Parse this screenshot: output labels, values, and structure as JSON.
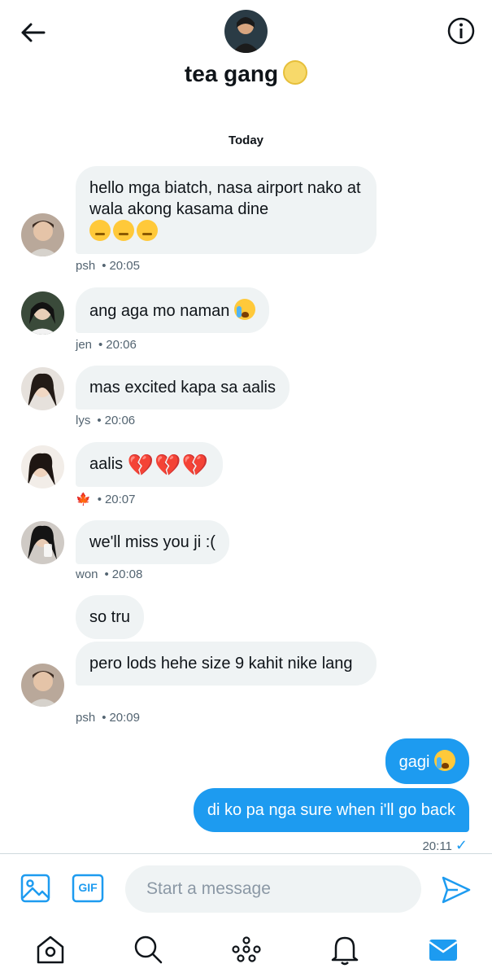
{
  "header": {
    "group_name": "tea gang",
    "back_icon": "arrow-left-icon",
    "info_icon": "info-icon"
  },
  "date_separator": "Today",
  "messages": [
    {
      "sender": "psh",
      "time": "20:05",
      "text": "hello mga biatch, nasa airport nako at wala akong kasama dine"
    },
    {
      "sender": "jen",
      "time": "20:06",
      "text": "ang aga mo naman"
    },
    {
      "sender": "lys",
      "time": "20:06",
      "text": "mas excited kapa sa aalis"
    },
    {
      "sender": "🍁",
      "time": "20:07",
      "text": "aalis"
    },
    {
      "sender": "won",
      "time": "20:08",
      "text": "we'll miss you ji :("
    },
    {
      "sender": "",
      "time": "",
      "text": "so tru"
    },
    {
      "sender": "psh",
      "time": "20:09",
      "text": "pero lods hehe size 9 kahit nike lang"
    }
  ],
  "sent_messages": [
    {
      "text": "gagi"
    },
    {
      "text": "di ko pa nga sure when i'll go back"
    }
  ],
  "sent_time": "20:11",
  "composer": {
    "placeholder": "Start a message",
    "gif_label": "GIF"
  },
  "tabs": [
    "home",
    "search",
    "spaces",
    "notifications",
    "messages"
  ],
  "colors": {
    "accent": "#1d9bf0",
    "bubble": "#eff3f4",
    "muted": "#536471"
  }
}
